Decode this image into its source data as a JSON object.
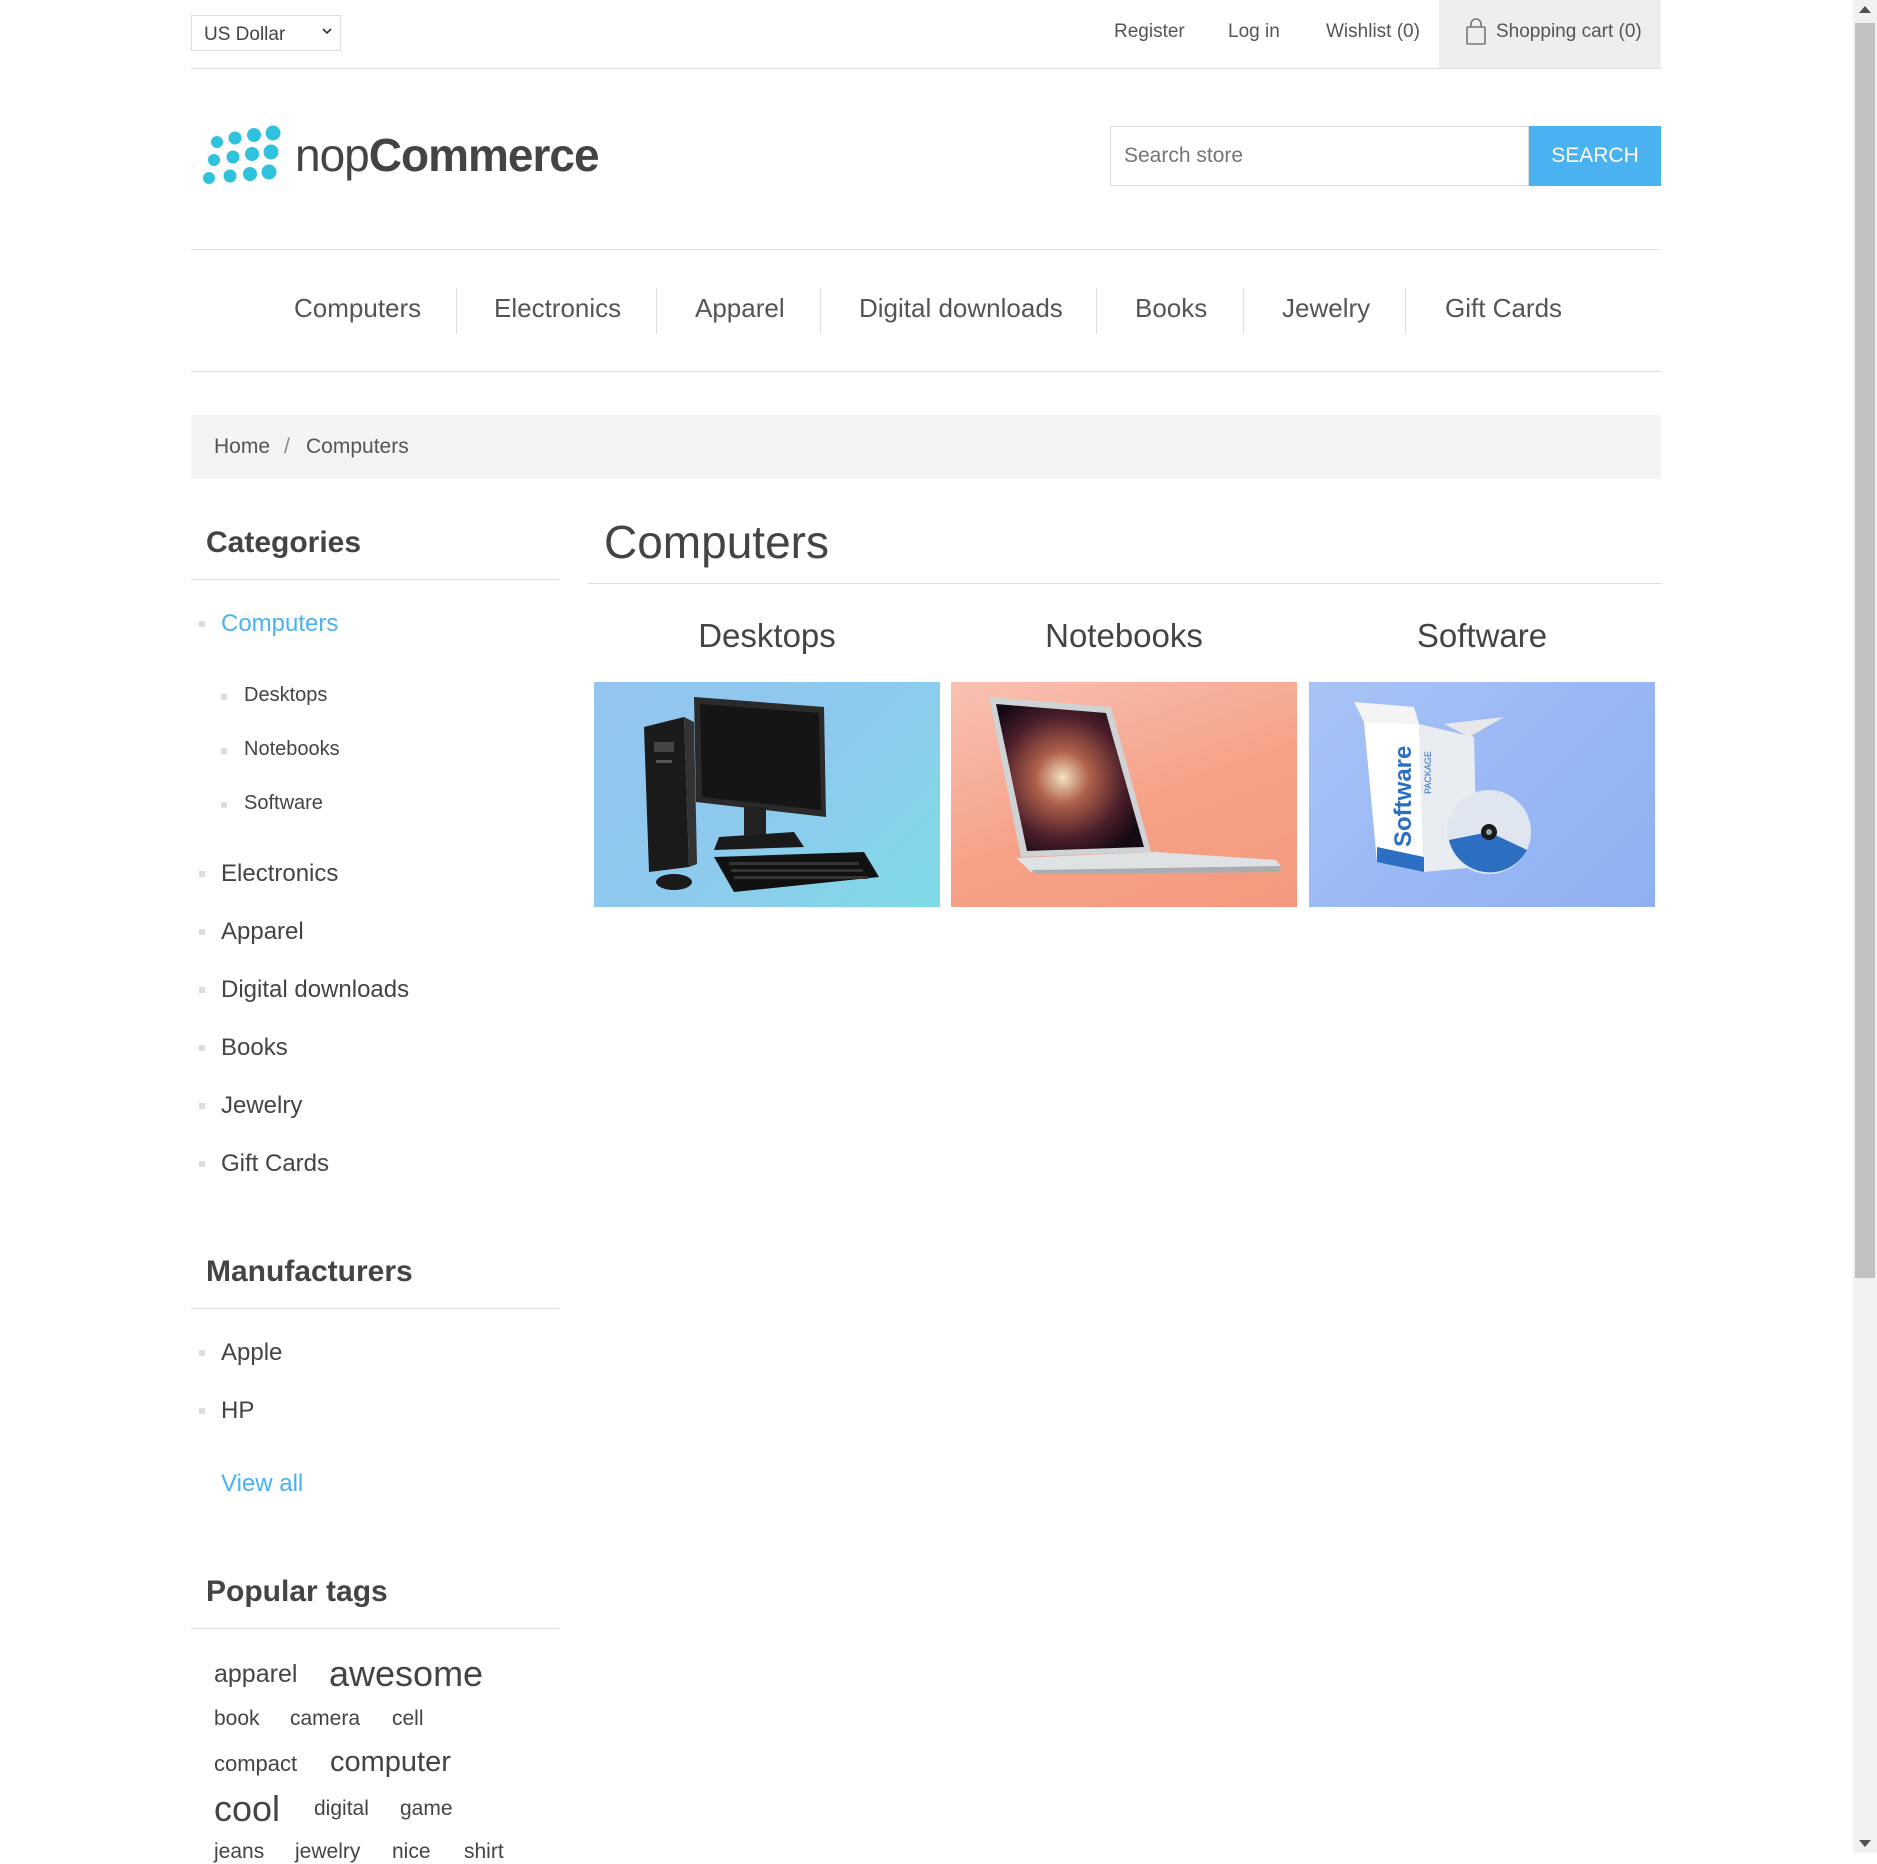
{
  "header": {
    "currency": "US Dollar",
    "register": "Register",
    "login": "Log in",
    "wishlist": "Wishlist (0)",
    "cart": "Shopping cart (0)"
  },
  "logo": {
    "part1": "nop",
    "part2": "Commerce",
    "color": "#2fc2dc"
  },
  "search": {
    "placeholder": "Search store",
    "button": "SEARCH"
  },
  "top_menu": [
    "Computers",
    "Electronics",
    "Apparel",
    "Digital downloads",
    "Books",
    "Jewelry",
    "Gift Cards"
  ],
  "breadcrumb": {
    "home": "Home",
    "separator": "/",
    "current": "Computers"
  },
  "sidebar": {
    "categories_title": "Categories",
    "categories": [
      "Computers",
      "Electronics",
      "Apparel",
      "Digital downloads",
      "Books",
      "Jewelry",
      "Gift Cards"
    ],
    "subcategories": [
      "Desktops",
      "Notebooks",
      "Software"
    ],
    "manufacturers_title": "Manufacturers",
    "manufacturers": [
      "Apple",
      "HP"
    ],
    "view_all": "View all",
    "tags_title": "Popular tags",
    "tags": [
      "apparel",
      "awesome",
      "book",
      "camera",
      "cell",
      "compact",
      "computer",
      "cool",
      "digital",
      "game",
      "jeans",
      "jewelry",
      "nice",
      "shirt"
    ]
  },
  "main": {
    "title": "Computers",
    "subcategories": [
      "Desktops",
      "Notebooks",
      "Software"
    ],
    "software_box_text": "Software",
    "software_box_subtext": "PACKAGE"
  },
  "colors": {
    "accent": "#4ab2f1",
    "text": "#444444",
    "border": "#dddddd"
  }
}
